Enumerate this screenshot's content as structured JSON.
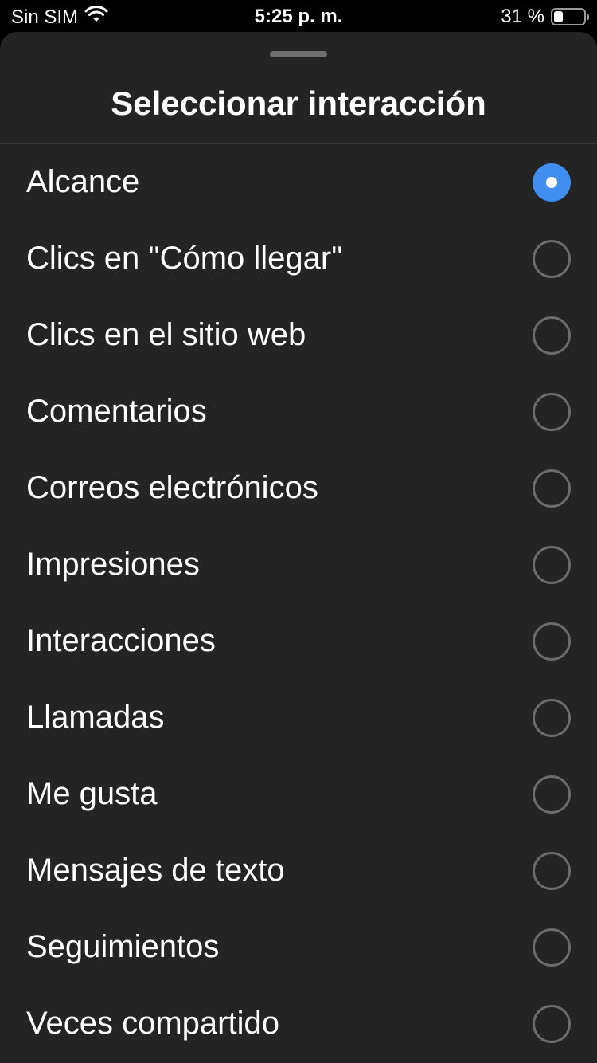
{
  "status_bar": {
    "carrier": "Sin SIM",
    "time": "5:25 p. m.",
    "battery_text": "31 %",
    "battery_level": 0.31,
    "wifi_icon": "wifi-icon"
  },
  "sheet": {
    "title": "Seleccionar interacción",
    "selected_index": 0,
    "accent_color": "#3f8ef0",
    "options": [
      {
        "label": "Alcance"
      },
      {
        "label": "Clics en \"Cómo llegar\""
      },
      {
        "label": "Clics en el sitio web"
      },
      {
        "label": "Comentarios"
      },
      {
        "label": "Correos electrónicos"
      },
      {
        "label": "Impresiones"
      },
      {
        "label": "Interacciones"
      },
      {
        "label": "Llamadas"
      },
      {
        "label": "Me gusta"
      },
      {
        "label": "Mensajes de texto"
      },
      {
        "label": "Seguimientos"
      },
      {
        "label": "Veces compartido"
      }
    ]
  }
}
